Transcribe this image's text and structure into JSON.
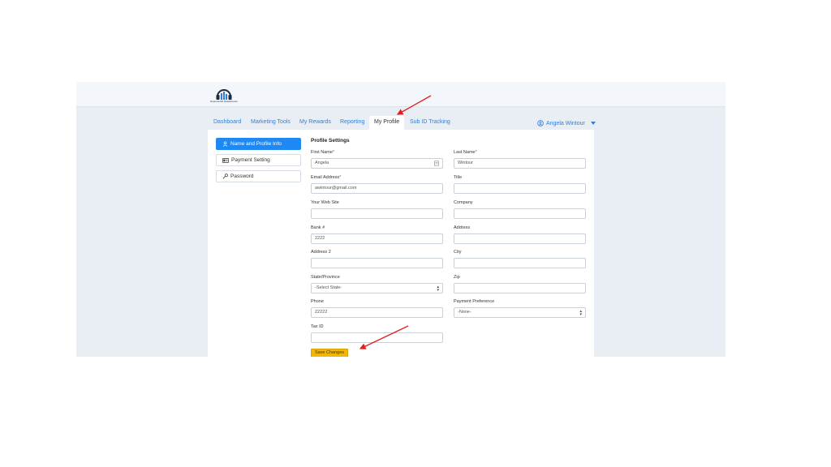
{
  "brand": {
    "logo_text": "Exponential Headphones"
  },
  "nav": {
    "tabs": [
      {
        "label": "Dashboard"
      },
      {
        "label": "Marketing Tools"
      },
      {
        "label": "My Rewards"
      },
      {
        "label": "Reporting"
      },
      {
        "label": "My Profile",
        "active": true
      },
      {
        "label": "Sub ID Tracking"
      }
    ],
    "user_name": "Angela Wintour"
  },
  "sidebar": {
    "items": [
      {
        "label": "Name and Profile Info",
        "icon": "user-icon",
        "active": true
      },
      {
        "label": "Payment Setting",
        "icon": "id-card-icon"
      },
      {
        "label": "Password",
        "icon": "key-icon"
      }
    ]
  },
  "form": {
    "title": "Profile Settings",
    "first_name": {
      "label": "First Name",
      "value": "Angela"
    },
    "last_name": {
      "label": "Last Name",
      "value": "Wintour"
    },
    "email": {
      "label": "Email Address",
      "value": "awintour@gmail.com"
    },
    "title_field": {
      "label": "Title",
      "value": ""
    },
    "website": {
      "label": "Your Web Site",
      "value": ""
    },
    "company": {
      "label": "Company",
      "value": ""
    },
    "bank": {
      "label": "Bank #",
      "value": "2222"
    },
    "address": {
      "label": "Address",
      "value": ""
    },
    "address2": {
      "label": "Address 2",
      "value": ""
    },
    "city": {
      "label": "City",
      "value": ""
    },
    "state": {
      "label": "State/Province",
      "value": "-Select State-"
    },
    "zip": {
      "label": "Zip",
      "value": ""
    },
    "phone": {
      "label": "Phone",
      "value": "22222"
    },
    "payment_pref": {
      "label": "Payment Preference",
      "value": "-None-"
    },
    "tax_id": {
      "label": "Tax ID",
      "value": ""
    },
    "required_mark": "*",
    "save_label": "Save Changes"
  },
  "colors": {
    "accent": "#1e88f5",
    "link": "#2f7fd6",
    "save_button": "#f2b705",
    "annotation_arrow": "#e02020"
  }
}
